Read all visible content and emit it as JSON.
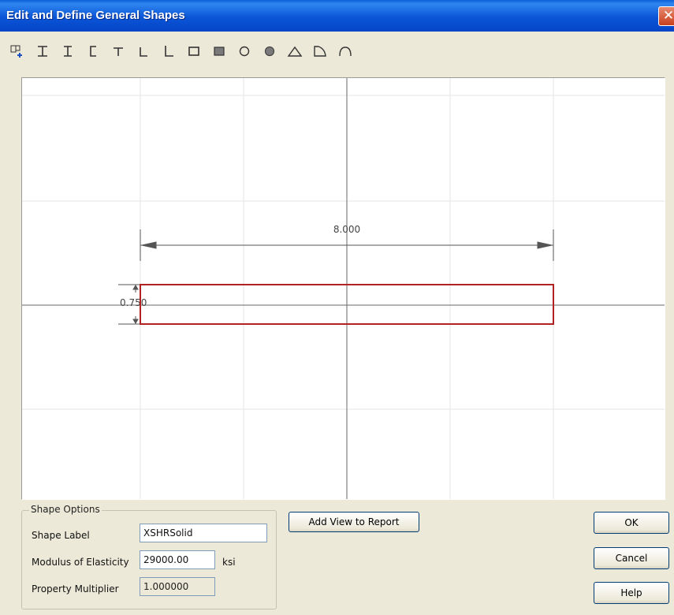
{
  "window": {
    "title": "Edit and Define General Shapes",
    "close_glyph": "✕"
  },
  "toolbar": {
    "tools": [
      {
        "icon": "add-shape-icon"
      },
      {
        "icon": "i-beam-icon"
      },
      {
        "icon": "i-beam-wide-icon"
      },
      {
        "icon": "channel-icon"
      },
      {
        "icon": "tee-icon"
      },
      {
        "icon": "angle-icon"
      },
      {
        "icon": "angle-long-icon"
      },
      {
        "icon": "rectangle-icon"
      },
      {
        "icon": "filled-rectangle-icon"
      },
      {
        "icon": "circle-icon"
      },
      {
        "icon": "filled-circle-icon"
      },
      {
        "icon": "triangle-icon"
      },
      {
        "icon": "quarter-round-icon"
      },
      {
        "icon": "arc-icon"
      }
    ]
  },
  "drawing": {
    "width_dimension": "8.000",
    "height_dimension": "0.750",
    "shape_color": "#b22222"
  },
  "shape_options": {
    "title": "Shape Options",
    "shape_label_label": "Shape Label",
    "shape_label_value": "XSHRSolid",
    "modulus_label": "Modulus of Elasticity",
    "modulus_value": "29000.00",
    "modulus_unit": "ksi",
    "multiplier_label": "Property Multiplier",
    "multiplier_value": "1.000000"
  },
  "buttons": {
    "add_view": "Add View to Report",
    "ok": "OK",
    "cancel": "Cancel",
    "help": "Help"
  }
}
